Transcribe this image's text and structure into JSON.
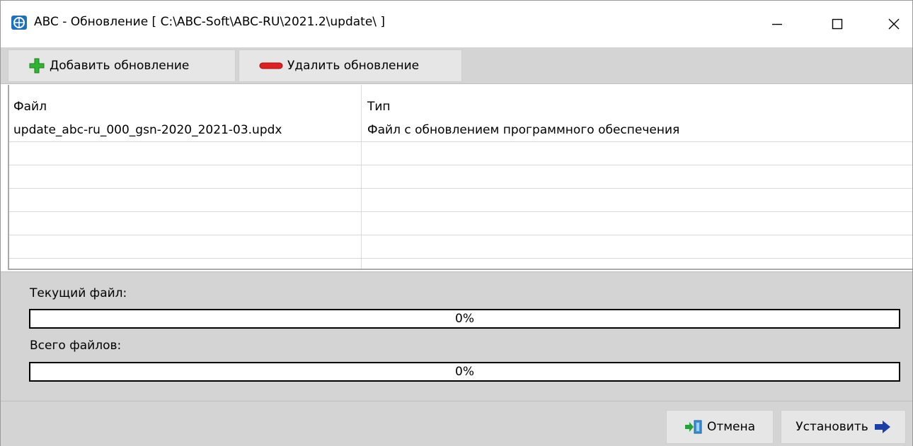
{
  "window": {
    "title": "ABC - Обновление [ C:\\ABC-Soft\\ABC-RU\\2021.2\\update\\ ]",
    "icon": "app-logo-icon"
  },
  "toolbar": {
    "add_label": "Добавить обновление",
    "add_icon": "plus-icon",
    "remove_label": "Удалить обновление",
    "remove_icon": "minus-icon"
  },
  "grid": {
    "columns": [
      "Файл",
      "Тип"
    ],
    "rows": [
      {
        "file": "update_abc-ru_000_gsn-2020_2021-03.updx",
        "type": "Файл с обновлением программного обеспечения"
      },
      {
        "file": "",
        "type": ""
      },
      {
        "file": "",
        "type": ""
      },
      {
        "file": "",
        "type": ""
      },
      {
        "file": "",
        "type": ""
      },
      {
        "file": "",
        "type": ""
      },
      {
        "file": "",
        "type": ""
      }
    ]
  },
  "progress": {
    "current_label": "Текущий файл:",
    "current_value": 0,
    "current_text": "0%",
    "total_label": "Всего файлов:",
    "total_value": 0,
    "total_text": "0%"
  },
  "footer": {
    "cancel_label": "Отмена",
    "cancel_icon": "exit-door-icon",
    "install_label": "Установить",
    "install_icon": "arrow-right-icon"
  },
  "colors": {
    "panel_bg": "#d4d4d4",
    "button_bg": "#e6e6e6",
    "plus_green": "#2fb52f",
    "minus_red": "#e02020",
    "arrow_blue": "#1a3fa6"
  }
}
